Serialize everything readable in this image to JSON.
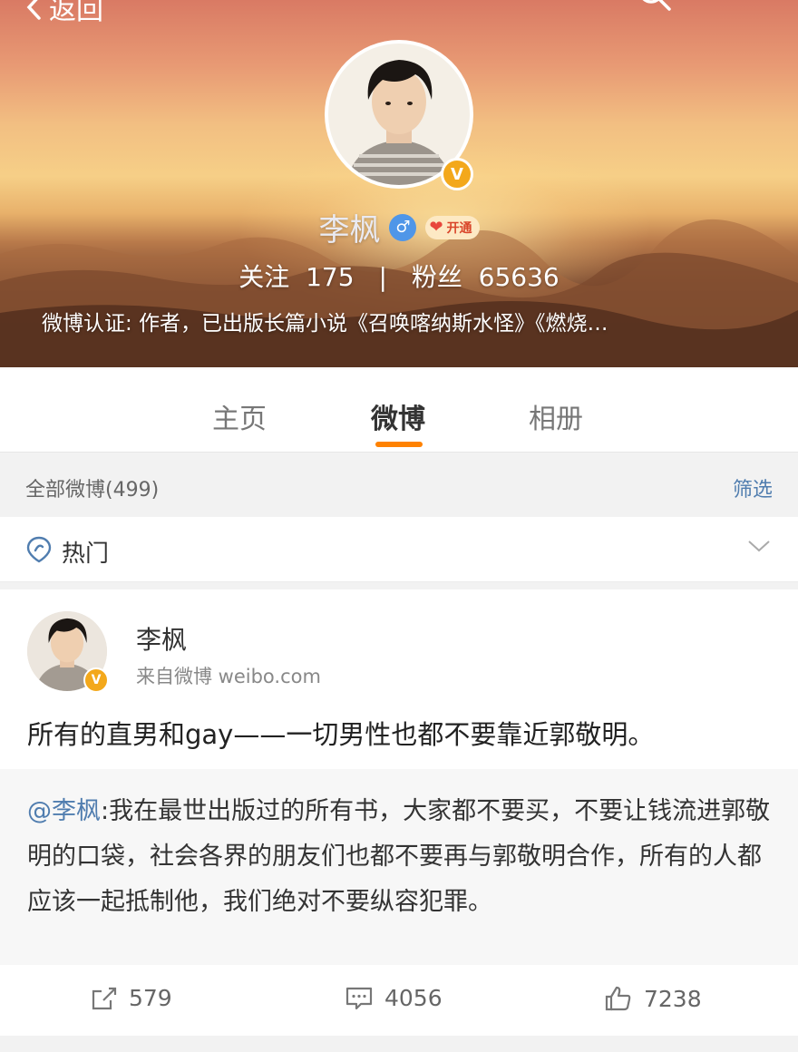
{
  "nav": {
    "back_label": "返回"
  },
  "profile": {
    "name": "李枫",
    "vip_label": "开通",
    "stats": {
      "follow_label": "关注",
      "follow_count": "175",
      "separator": "|",
      "fans_label": "粉丝",
      "fans_count": "65636"
    },
    "verification": "微博认证: 作者，已出版长篇小说《召唤喀纳斯水怪》《燃烧…"
  },
  "tabs": [
    {
      "label": "主页",
      "active": false
    },
    {
      "label": "微博",
      "active": true
    },
    {
      "label": "相册",
      "active": false
    }
  ],
  "filter": {
    "count_label": "全部微博(499)",
    "filter_label": "筛选"
  },
  "hot": {
    "label": "热门"
  },
  "post": {
    "author": "李枫",
    "source": "来自微博 weibo.com",
    "text": "所有的直男和gay——一切男性也都不要靠近郭敬明。",
    "repost": {
      "mention": "@李枫",
      "text": ":我在最世出版过的所有书，大家都不要买，不要让钱流进郭敬明的口袋，社会各界的朋友们也都不要再与郭敬明合作，所有的人都应该一起抵制他，我们绝对不要纵容犯罪。"
    },
    "actions": {
      "repost_count": "579",
      "comment_count": "4056",
      "like_count": "7238"
    }
  },
  "colors": {
    "accent_orange": "#ff8200",
    "link_blue": "#507daf",
    "verified_gold": "#f3a81b"
  }
}
